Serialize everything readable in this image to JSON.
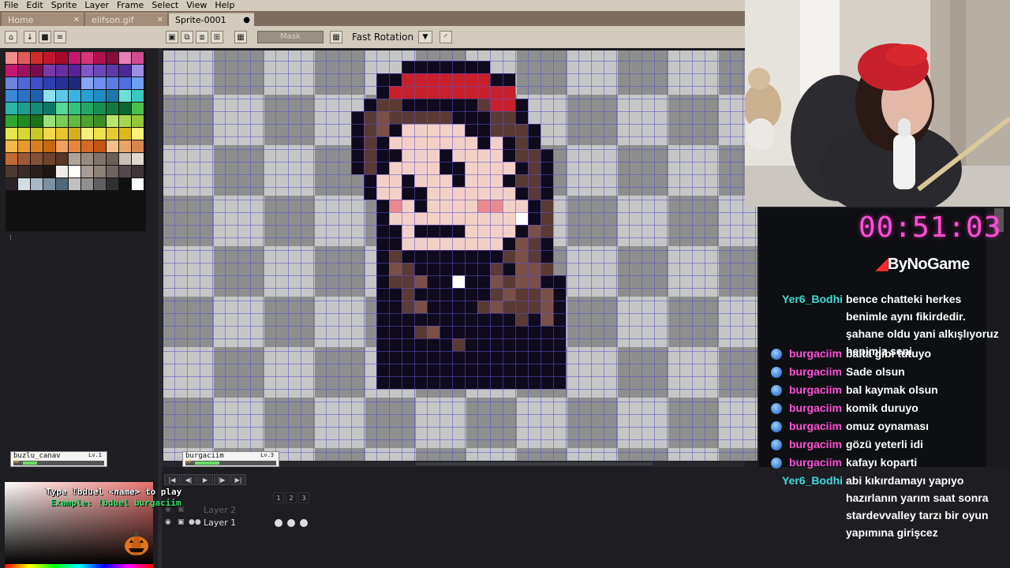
{
  "menu": [
    "File",
    "Edit",
    "Sprite",
    "Layer",
    "Frame",
    "Select",
    "View",
    "Help"
  ],
  "tabs": [
    {
      "label": "Home",
      "active": false
    },
    {
      "label": "elifson.gif",
      "active": false
    },
    {
      "label": "Sprite-0001",
      "active": true
    }
  ],
  "toolbar": {
    "mask_label": "Mask",
    "rotation_label": "Fast Rotation"
  },
  "palette": [
    "#f28c8c",
    "#e05a5a",
    "#d32b2b",
    "#c0162f",
    "#a30a2a",
    "#c2186b",
    "#d6357a",
    "#b0104d",
    "#8a0c3a",
    "#e680b4",
    "#d04b8f",
    "#c21870",
    "#a01060",
    "#7c0a4e",
    "#7c3aa8",
    "#6a2ea0",
    "#5a2196",
    "#8059c6",
    "#6b49b8",
    "#5d3aa8",
    "#4a2a98",
    "#9a8fe0",
    "#6e82e0",
    "#4f6ad6",
    "#3e4fc8",
    "#2f3fb2",
    "#263196",
    "#1f2a7c",
    "#8aa6f2",
    "#6f8ff0",
    "#5a7ce8",
    "#4f6ee0",
    "#6da0f2",
    "#3c86d8",
    "#2a72c6",
    "#1f5fae",
    "#8ee0f2",
    "#5cc7ea",
    "#3bb3e0",
    "#2aa0d2",
    "#1e8cc0",
    "#1978a8",
    "#6ce0d8",
    "#38c8c0",
    "#2ab5a8",
    "#1e9e90",
    "#138a7a",
    "#0e7866",
    "#56d89a",
    "#34c27e",
    "#22a866",
    "#188f52",
    "#107a40",
    "#0a6630",
    "#4bbf4b",
    "#2fa52f",
    "#1e8c1e",
    "#1a7318",
    "#9ae07a",
    "#7ccc5c",
    "#62b842",
    "#4ea332",
    "#3c8e24",
    "#b8e66a",
    "#a6d84e",
    "#94c838",
    "#e6e64a",
    "#d8d834",
    "#c8c826",
    "#f2d84a",
    "#e8c42e",
    "#d6ae1e",
    "#f2f07a",
    "#f0e04a",
    "#e8cc2e",
    "#dcb81e",
    "#fff07a",
    "#f2b84a",
    "#e89a2e",
    "#d6801e",
    "#c46614",
    "#f0a060",
    "#e88640",
    "#d46a28",
    "#c25418",
    "#f2c08a",
    "#e8a46a",
    "#d68850",
    "#c46a34",
    "#9c5a3a",
    "#845036",
    "#6e422c",
    "#5a3424",
    "#b0a49a",
    "#988c82",
    "#80746a",
    "#6a5e56",
    "#c8c0b8",
    "#e0d8d0",
    "#4a3a32",
    "#3a2c26",
    "#2c201c",
    "#1e1614",
    "#f0ece8",
    "#ffffff",
    "#a89c94",
    "#8c8078",
    "#706460",
    "#54484a",
    "#3e3438",
    "#2a2226",
    "#d4dde4",
    "#a8b8c4",
    "#7c90a0",
    "#506878",
    "#c0c0c0",
    "#909090",
    "#606060",
    "#303030",
    "#101010",
    "#ffffff"
  ],
  "sprite": {
    "legend": {
      "K": "#0f0a1c",
      "R": "#c8202a",
      "H": "#5a3a34",
      "M": "#7a5048",
      "S": "#f2d0c8",
      "P": "#e88a90",
      "W": "#ffffff"
    },
    "rows": [
      "..............................................",
      "..............................................",
      "..............................................",
      "..............................................",
      "..............................................",
      "..............................................",
      "..............................................",
      "..............................................",
      "..............................................",
      "..................KKKKKKK.....................",
      "................KKRRRRRRRKK...................",
      "................KRRRRRRRRRR...................",
      "...............KHHKKKKKKHRRK..................",
      "..............KHMHHHHHKKKHHK..................",
      "..............KHMKSSSSSKKHHHK.................",
      "..............KHKSSSSSSSKSKHK.................",
      "..............KHKKSSSKSSSSKHHK................",
      "..............KHKSSSSKKSSSSKHK................",
      "...............KSSKSSSKSSSKHHK................",
      "...............KSSKKSSSSSSSKHK................",
      "................KPSKSSSSPPSSKH................",
      "................KSSSSSSSSSSWKH................",
      "................KKSKKKKSSSSKMH................",
      "................KKSSSSSSSSKMHK................",
      "................KHKKKKKKKKHMHK................",
      "................KMHKKKKKKHKMMH................",
      "................KHHMKKWKKMHMMKK...............",
      "................KKHKKKKKKHMHHMK...............",
      "................KKHMKKKKHMHHHMK...............",
      "................KKKKKKKKKKKHKMK...............",
      "................KKKHMKKKKKKKKKK...............",
      "................KKKKKKHKKKKKKKK...............",
      "................KKKKKKKKKKKKKKK...............",
      "................KKKKKKKKKKKKKKK...............",
      "................KKKKKKKKKKKKKKK...............",
      "..............................................",
      ".............................................."
    ]
  },
  "player_cards": [
    {
      "name": "buzlu_canav",
      "level": "Lv.1",
      "hp_label": "HP:",
      "hp": 0.2
    },
    {
      "name": "burgaciim",
      "level": "Lv.3",
      "hp_label": "HP:",
      "hp": 0.35
    }
  ],
  "timeline": {
    "layers": [
      "Layer 2",
      "Layer 1"
    ],
    "frames": [
      "1",
      "2",
      "3"
    ],
    "controls": [
      "first-frame",
      "prev-frame",
      "play",
      "next-frame",
      "last-frame"
    ]
  },
  "duel": {
    "instruction": "Type !bduel <name> to play",
    "example": "Example: !bduel burgaciim"
  },
  "stream": {
    "timer": "00:51:03",
    "brand": "ByNoGame"
  },
  "chat": [
    {
      "user": "Yer6_Bodhi",
      "user_color": "#3fdcd6",
      "badge": false,
      "text": "bence chatteki herkes benimle aynı fikirdedir. şahane oldu yani alkışlıyoruz hepimiz seni",
      "lines": 3
    },
    {
      "user": "burgaciim",
      "user_color": "#ff4fd6",
      "badge": true,
      "text": "balta gibi tutuyo",
      "lines": 1
    },
    {
      "user": "burgaciim",
      "user_color": "#ff4fd6",
      "badge": true,
      "text": "Sade olsun",
      "lines": 1
    },
    {
      "user": "burgaciim",
      "user_color": "#ff4fd6",
      "badge": true,
      "text": "bal kaymak olsun",
      "lines": 1
    },
    {
      "user": "burgaciim",
      "user_color": "#ff4fd6",
      "badge": true,
      "text": "komik duruyo",
      "lines": 1
    },
    {
      "user": "burgaciim",
      "user_color": "#ff4fd6",
      "badge": true,
      "text": "omuz oynaması",
      "lines": 1
    },
    {
      "user": "burgaciim",
      "user_color": "#ff4fd6",
      "badge": true,
      "text": "gözü yeterli idi",
      "lines": 1
    },
    {
      "user": "burgaciim",
      "user_color": "#ff4fd6",
      "badge": true,
      "text": "kafayı koparti",
      "lines": 1
    },
    {
      "user": "Yer6_Bodhi",
      "user_color": "#3fdcd6",
      "badge": false,
      "text": "abi kıkırdamayı yapıyo hazırlanın yarım saat sonra stardevvalley tarzı bir oyun yapımına girişcez",
      "lines": 4
    }
  ]
}
